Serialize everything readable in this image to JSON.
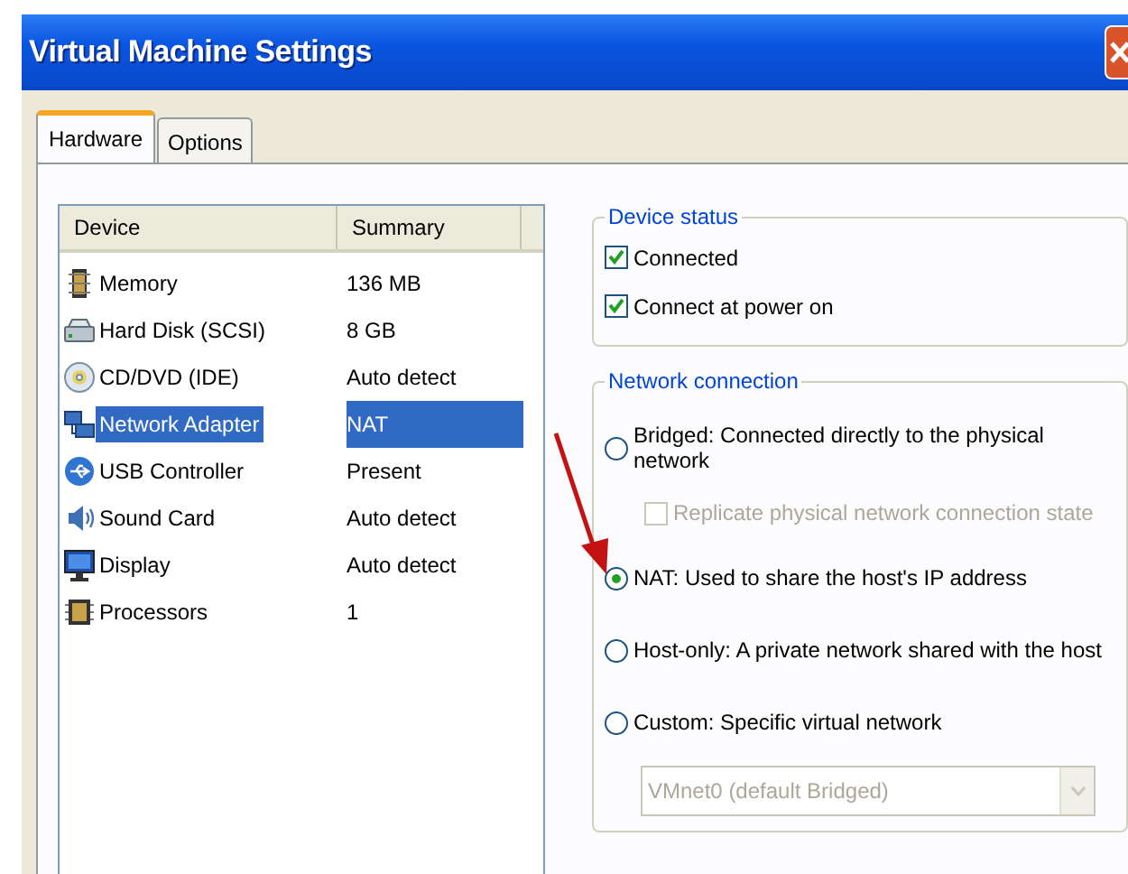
{
  "window": {
    "title": "Virtual Machine Settings"
  },
  "tabs": [
    {
      "label": "Hardware",
      "selected": true
    },
    {
      "label": "Options",
      "selected": false
    }
  ],
  "device_table": {
    "columns": [
      "Device",
      "Summary"
    ],
    "rows": [
      {
        "kind": "memory",
        "device": "Memory",
        "summary": "136 MB",
        "selected": false
      },
      {
        "kind": "disk",
        "device": "Hard Disk (SCSI)",
        "summary": "8 GB",
        "selected": false
      },
      {
        "kind": "cd",
        "device": "CD/DVD (IDE)",
        "summary": "Auto detect",
        "selected": false
      },
      {
        "kind": "network",
        "device": "Network Adapter",
        "summary": "NAT",
        "selected": true
      },
      {
        "kind": "usb",
        "device": "USB Controller",
        "summary": "Present",
        "selected": false
      },
      {
        "kind": "sound",
        "device": "Sound Card",
        "summary": "Auto detect",
        "selected": false
      },
      {
        "kind": "display",
        "device": "Display",
        "summary": "Auto detect",
        "selected": false
      },
      {
        "kind": "processor",
        "device": "Processors",
        "summary": "1",
        "selected": false
      }
    ]
  },
  "device_status": {
    "title": "Device status",
    "checkboxes": [
      {
        "label": "Connected",
        "checked": true
      },
      {
        "label": "Connect at power on",
        "checked": true
      }
    ]
  },
  "network_connection": {
    "title": "Network connection",
    "options": [
      {
        "label": "Bridged: Connected directly to the physical network",
        "selected": false,
        "child": {
          "kind": "checkbox",
          "label": "Replicate physical network connection state",
          "checked": false,
          "disabled": true
        }
      },
      {
        "label": "NAT: Used to share the host's IP address",
        "selected": true
      },
      {
        "label": "Host-only: A private network shared with the host",
        "selected": false
      },
      {
        "label": "Custom: Specific virtual network",
        "selected": false,
        "child": {
          "kind": "dropdown",
          "value": "VMnet0 (default Bridged)",
          "disabled": true
        }
      }
    ]
  }
}
